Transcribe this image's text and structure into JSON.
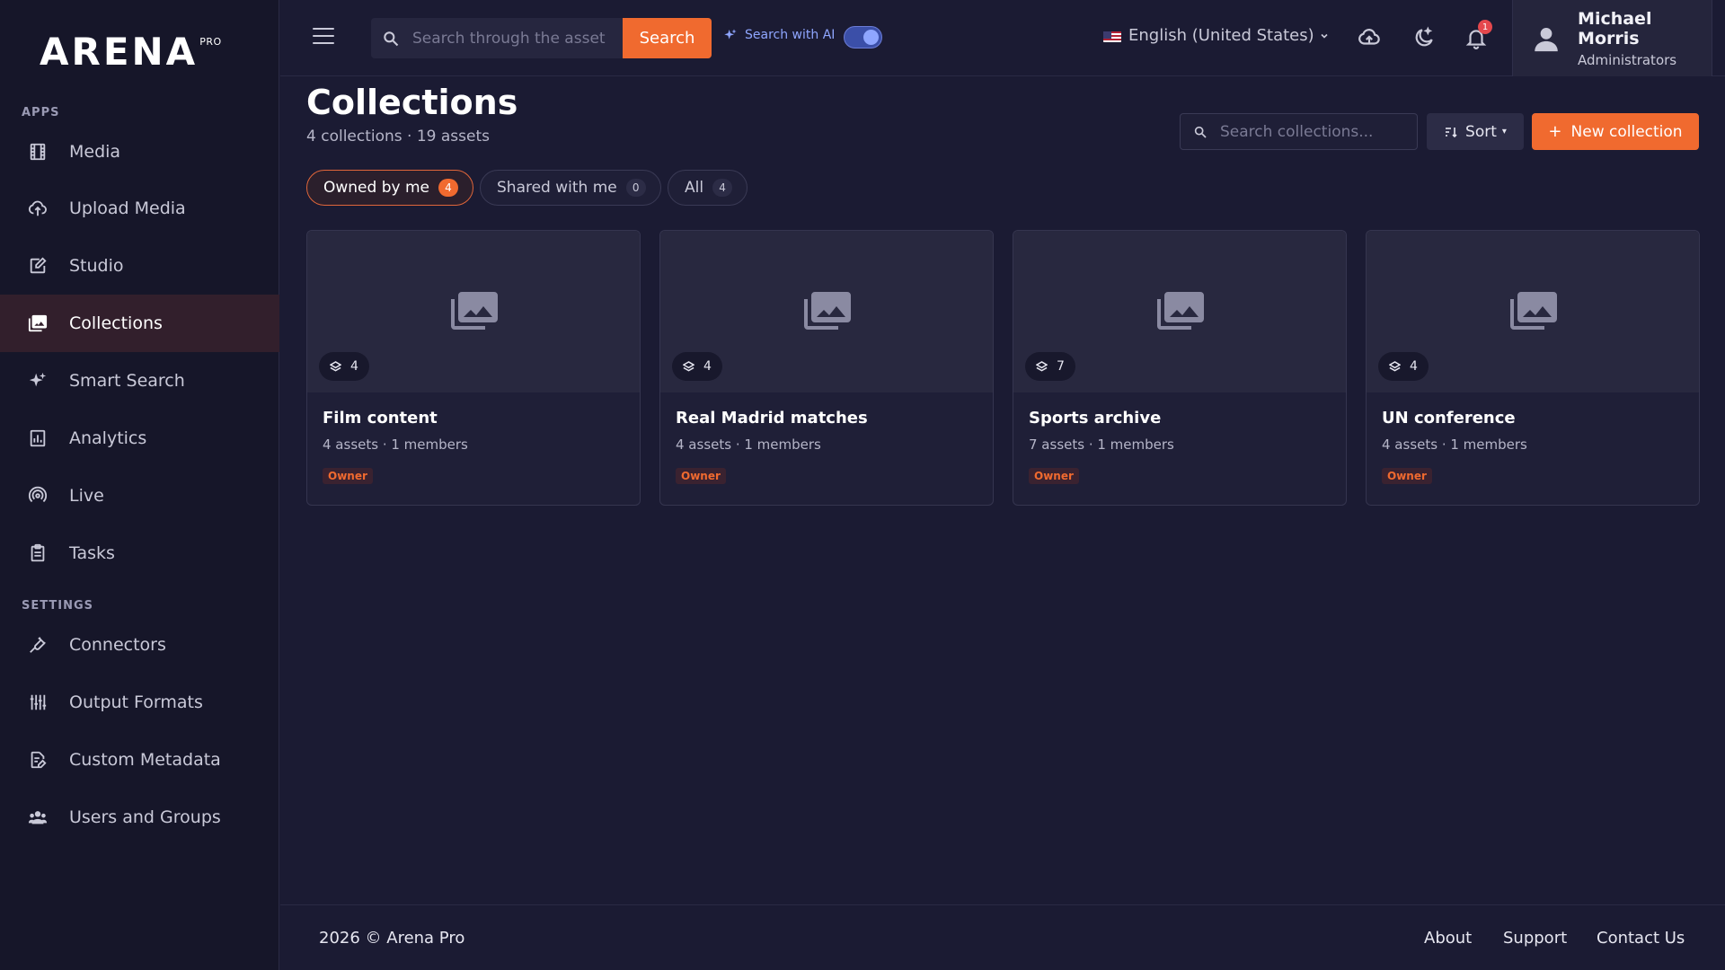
{
  "brand": {
    "name": "ARENA",
    "tier": "PRO"
  },
  "sidebar": {
    "apps_label": "APPS",
    "settings_label": "SETTINGS",
    "apps": [
      {
        "label": "Media",
        "icon": "film-icon"
      },
      {
        "label": "Upload Media",
        "icon": "cloud-upload-icon"
      },
      {
        "label": "Studio",
        "icon": "edit-icon"
      },
      {
        "label": "Collections",
        "icon": "photo-library-icon",
        "active": true
      },
      {
        "label": "Smart Search",
        "icon": "sparkle-icon"
      },
      {
        "label": "Analytics",
        "icon": "bar-chart-icon"
      },
      {
        "label": "Live",
        "icon": "broadcast-icon"
      },
      {
        "label": "Tasks",
        "icon": "clipboard-icon"
      }
    ],
    "settings": [
      {
        "label": "Connectors",
        "icon": "plug-icon"
      },
      {
        "label": "Output Formats",
        "icon": "sliders-icon"
      },
      {
        "label": "Custom Metadata",
        "icon": "document-edit-icon"
      },
      {
        "label": "Users and Groups",
        "icon": "users-icon"
      }
    ]
  },
  "topbar": {
    "search_placeholder": "Search through the assets",
    "search_button": "Search",
    "ai_search_label": "Search with AI",
    "ai_search_enabled": true,
    "language": "English (United States)",
    "notification_count": "1",
    "user": {
      "name": "Michael Morris",
      "role": "Administrators"
    }
  },
  "page": {
    "title": "Collections",
    "subtitle": "4 collections · 19 assets",
    "search_placeholder": "Search collections...",
    "sort_label": "Sort",
    "new_button": "New collection",
    "filters": [
      {
        "label": "Owned by me",
        "count": "4",
        "active": true
      },
      {
        "label": "Shared with me",
        "count": "0",
        "active": false
      },
      {
        "label": "All",
        "count": "4",
        "active": false
      }
    ],
    "collections": [
      {
        "title": "Film content",
        "asset_count": "4",
        "meta": "4 assets · 1 members",
        "role": "Owner"
      },
      {
        "title": "Real Madrid matches",
        "asset_count": "4",
        "meta": "4 assets · 1 members",
        "role": "Owner"
      },
      {
        "title": "Sports archive",
        "asset_count": "7",
        "meta": "7 assets · 1 members",
        "role": "Owner"
      },
      {
        "title": "UN conference",
        "asset_count": "4",
        "meta": "4 assets · 1 members",
        "role": "Owner"
      }
    ]
  },
  "footer": {
    "copyright": "2026 © Arena Pro",
    "links": [
      "About",
      "Support",
      "Contact Us"
    ]
  },
  "colors": {
    "accent": "#f06a2f",
    "background": "#1b1b33",
    "sidebar": "#161629",
    "ai": "#8fa6ff"
  }
}
